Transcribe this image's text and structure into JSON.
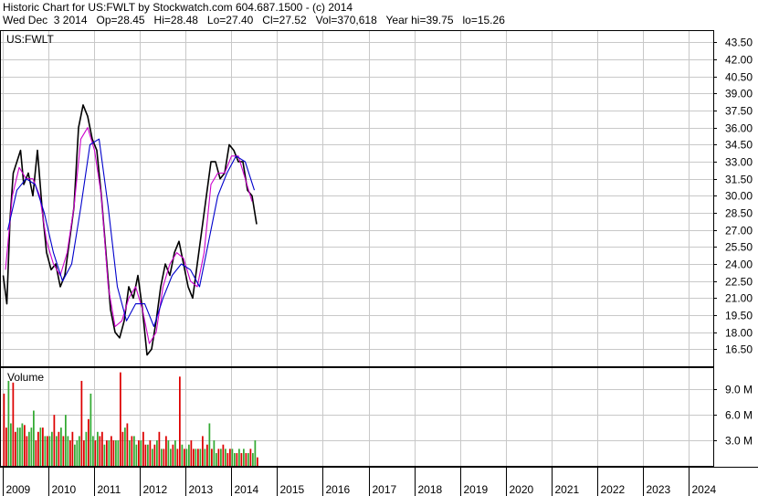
{
  "header": {
    "line1": "Historic Chart for US:FWLT by Stockwatch.com 604.687.1500 - (c) 2014",
    "line2": "Wed Dec  3 2014   Op=28.45   Hi=28.48   Lo=27.40   Cl=27.52   Vol=370,618   Year hi=39.75   lo=15.26"
  },
  "chart_data": {
    "type": "line",
    "symbol": "US:FWLT",
    "price_panel": {
      "label": "US:FWLT",
      "ylim": [
        15.0,
        44.5
      ],
      "yticks": [
        "43.50",
        "42.00",
        "40.50",
        "39.00",
        "37.50",
        "36.00",
        "34.50",
        "33.00",
        "31.50",
        "30.00",
        "28.50",
        "27.00",
        "25.50",
        "24.00",
        "22.50",
        "21.00",
        "19.50",
        "18.00",
        "16.50"
      ],
      "series": [
        {
          "color": "#000000",
          "x": [
            2009.0,
            2009.08,
            2009.15,
            2009.22,
            2009.3,
            2009.38,
            2009.45,
            2009.55,
            2009.65,
            2009.75,
            2009.85,
            2009.95,
            2010.05,
            2010.15,
            2010.25,
            2010.35,
            2010.45,
            2010.55,
            2010.65,
            2010.75,
            2010.85,
            2010.95,
            2011.05,
            2011.15,
            2011.25,
            2011.35,
            2011.45,
            2011.55,
            2011.65,
            2011.75,
            2011.85,
            2011.95,
            2012.05,
            2012.15,
            2012.25,
            2012.35,
            2012.45,
            2012.55,
            2012.65,
            2012.75,
            2012.85,
            2012.95,
            2013.05,
            2013.15,
            2013.25,
            2013.35,
            2013.45,
            2013.55,
            2013.65,
            2013.75,
            2013.85,
            2013.95,
            2014.05,
            2014.15,
            2014.25,
            2014.35,
            2014.45,
            2014.55
          ],
          "y": [
            23,
            20.5,
            28,
            32,
            33,
            34,
            31,
            32,
            30,
            34,
            29,
            25,
            23.5,
            24,
            22,
            23,
            26,
            29,
            36,
            38,
            37,
            35,
            34,
            30,
            25,
            20,
            18,
            17.5,
            19,
            22,
            21,
            23,
            20,
            16,
            16.5,
            19,
            22,
            24,
            23,
            25,
            26,
            24,
            22,
            21,
            24,
            27,
            30,
            33,
            33,
            31.5,
            32,
            34.5,
            34,
            33,
            33,
            30.5,
            30,
            27.5
          ]
        },
        {
          "color": "#cc00cc",
          "x": [
            2009.05,
            2009.2,
            2009.35,
            2009.5,
            2009.65,
            2009.8,
            2009.95,
            2010.1,
            2010.25,
            2010.4,
            2010.55,
            2010.7,
            2010.85,
            2011.0,
            2011.15,
            2011.3,
            2011.45,
            2011.6,
            2011.75,
            2011.9,
            2012.05,
            2012.2,
            2012.35,
            2012.5,
            2012.65,
            2012.8,
            2012.95,
            2013.1,
            2013.25,
            2013.4,
            2013.55,
            2013.7,
            2013.85,
            2014.0,
            2014.15,
            2014.3,
            2014.45
          ],
          "y": [
            23.5,
            30,
            32.5,
            31.5,
            31.5,
            30,
            26,
            24,
            23,
            25,
            29,
            35,
            36,
            34,
            30,
            22,
            18.5,
            19,
            21,
            22,
            20,
            17,
            18,
            22,
            24,
            25,
            24.5,
            22.5,
            22,
            25,
            31,
            32,
            32,
            33.5,
            33.5,
            31.5,
            29.5
          ]
        },
        {
          "color": "#0000cc",
          "x": [
            2009.1,
            2009.3,
            2009.5,
            2009.7,
            2009.9,
            2010.1,
            2010.3,
            2010.5,
            2010.7,
            2010.9,
            2011.1,
            2011.3,
            2011.5,
            2011.7,
            2011.9,
            2012.1,
            2012.3,
            2012.5,
            2012.7,
            2012.9,
            2013.1,
            2013.3,
            2013.5,
            2013.7,
            2013.9,
            2014.1,
            2014.3,
            2014.5
          ],
          "y": [
            27,
            30.5,
            31.5,
            31,
            28.5,
            25,
            22.5,
            24,
            29,
            34.5,
            35,
            29,
            22,
            19,
            20.5,
            20.5,
            18.5,
            21,
            23,
            24,
            23.5,
            22,
            26,
            30,
            32,
            33.5,
            33,
            30.5
          ]
        }
      ]
    },
    "volume_panel": {
      "label": "Volume",
      "ylim": [
        0,
        11.5
      ],
      "yticks": [
        "9.0 M",
        "6.0 M",
        "3.0 M"
      ],
      "unit": "M",
      "colors": {
        "up": "#33aa33",
        "down": "#dd0000"
      },
      "x": [
        2009.0,
        2009.05,
        2009.1,
        2009.15,
        2009.2,
        2009.25,
        2009.3,
        2009.35,
        2009.4,
        2009.45,
        2009.5,
        2009.55,
        2009.6,
        2009.65,
        2009.7,
        2009.75,
        2009.8,
        2009.85,
        2009.9,
        2009.95,
        2010.0,
        2010.05,
        2010.1,
        2010.15,
        2010.2,
        2010.25,
        2010.3,
        2010.35,
        2010.4,
        2010.45,
        2010.5,
        2010.55,
        2010.6,
        2010.65,
        2010.7,
        2010.75,
        2010.8,
        2010.85,
        2010.9,
        2010.95,
        2011.0,
        2011.05,
        2011.1,
        2011.15,
        2011.2,
        2011.25,
        2011.3,
        2011.35,
        2011.4,
        2011.45,
        2011.5,
        2011.55,
        2011.6,
        2011.65,
        2011.7,
        2011.75,
        2011.8,
        2011.85,
        2011.9,
        2011.95,
        2012.0,
        2012.05,
        2012.1,
        2012.15,
        2012.2,
        2012.25,
        2012.3,
        2012.35,
        2012.4,
        2012.45,
        2012.5,
        2012.55,
        2012.6,
        2012.65,
        2012.7,
        2012.75,
        2012.8,
        2012.85,
        2012.9,
        2012.95,
        2013.0,
        2013.05,
        2013.1,
        2013.15,
        2013.2,
        2013.25,
        2013.3,
        2013.35,
        2013.4,
        2013.45,
        2013.5,
        2013.55,
        2013.6,
        2013.65,
        2013.7,
        2013.75,
        2013.8,
        2013.85,
        2013.9,
        2013.95,
        2014.0,
        2014.05,
        2014.1,
        2014.15,
        2014.2,
        2014.25,
        2014.3,
        2014.35,
        2014.4,
        2014.45,
        2014.5,
        2014.55
      ],
      "values": [
        8.5,
        4.5,
        10,
        5,
        9.8,
        4,
        4.5,
        4.5,
        5,
        4.8,
        3.5,
        4,
        4.5,
        6.5,
        3,
        4,
        4.5,
        4.5,
        3.5,
        3.5,
        3.5,
        4,
        6,
        3.5,
        4,
        4.5,
        3.5,
        6,
        3.5,
        3,
        4,
        2.5,
        3,
        3.5,
        10,
        3,
        4,
        5.5,
        8.5,
        3.5,
        3,
        4,
        3.5,
        4,
        2.5,
        3,
        3,
        3.5,
        3,
        3,
        3,
        11,
        4,
        4.5,
        5,
        3,
        3.5,
        3.5,
        2.5,
        3,
        3,
        4,
        2.5,
        2.5,
        3,
        2,
        2.5,
        3,
        4,
        2,
        2,
        3.5,
        3,
        2,
        2.5,
        3,
        2,
        10.5,
        2.5,
        2,
        2,
        2.5,
        3,
        2,
        2,
        2,
        2,
        3.5,
        2,
        2.5,
        5,
        2,
        3,
        1.5,
        2,
        2,
        2.5,
        2,
        1.5,
        2,
        2,
        1.5,
        1.5,
        2,
        1.5,
        2,
        1.5,
        1.5,
        2,
        1.5,
        3,
        1
      ],
      "up": [
        0,
        0,
        1,
        1,
        0,
        0,
        1,
        1,
        1,
        0,
        0,
        1,
        1,
        1,
        0,
        0,
        1,
        0,
        1,
        0,
        1,
        1,
        0,
        1,
        0,
        1,
        0,
        1,
        1,
        0,
        0,
        1,
        1,
        1,
        0,
        0,
        1,
        0,
        1,
        1,
        0,
        1,
        0,
        0,
        1,
        0,
        1,
        0,
        0,
        1,
        1,
        0,
        0,
        1,
        0,
        1,
        0,
        1,
        1,
        0,
        1,
        0,
        0,
        1,
        0,
        1,
        0,
        1,
        0,
        1,
        0,
        0,
        1,
        1,
        0,
        1,
        0,
        0,
        1,
        0,
        1,
        1,
        0,
        0,
        1,
        0,
        1,
        0,
        1,
        0,
        1,
        0,
        1,
        1,
        0,
        1,
        0,
        1,
        0,
        0,
        1,
        1,
        0,
        1,
        0,
        1,
        0,
        1,
        0,
        1,
        1,
        0
      ]
    },
    "x_axis": {
      "labels": [
        "2009",
        "2010",
        "2011",
        "2012",
        "2013",
        "2014",
        "2015",
        "2016",
        "2017",
        "2018",
        "2019",
        "2020",
        "2021",
        "2022",
        "2023",
        "2024"
      ],
      "range": [
        2008.95,
        2024.55
      ]
    },
    "grid": true
  }
}
